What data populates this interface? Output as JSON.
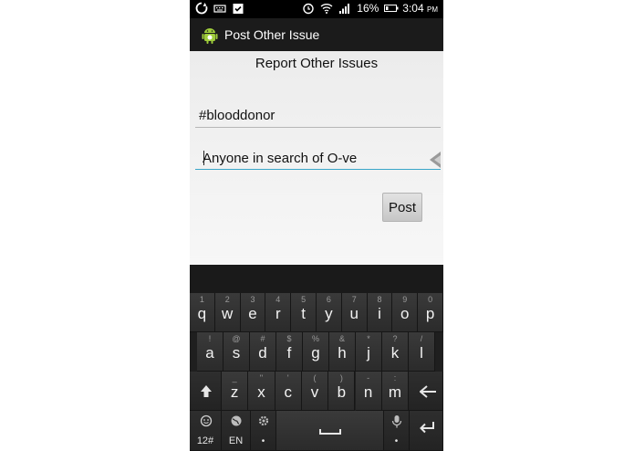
{
  "status_bar": {
    "battery": "16%",
    "time": "3:04",
    "ampm": "PM"
  },
  "action_bar": {
    "title": "Post Other Issue"
  },
  "content": {
    "heading": "Report Other Issues",
    "hashtag_value": "#blooddonor",
    "message_value": "Anyone in search of O-ve",
    "post_label": "Post"
  },
  "keyboard": {
    "row1": [
      {
        "main": "q",
        "sub": "1"
      },
      {
        "main": "w",
        "sub": "2"
      },
      {
        "main": "e",
        "sub": "3"
      },
      {
        "main": "r",
        "sub": "4"
      },
      {
        "main": "t",
        "sub": "5"
      },
      {
        "main": "y",
        "sub": "6"
      },
      {
        "main": "u",
        "sub": "7"
      },
      {
        "main": "i",
        "sub": "8"
      },
      {
        "main": "o",
        "sub": "9"
      },
      {
        "main": "p",
        "sub": "0"
      }
    ],
    "row2": [
      {
        "main": "a",
        "sub": "!"
      },
      {
        "main": "s",
        "sub": "@"
      },
      {
        "main": "d",
        "sub": "#"
      },
      {
        "main": "f",
        "sub": "$"
      },
      {
        "main": "g",
        "sub": "%"
      },
      {
        "main": "h",
        "sub": "&"
      },
      {
        "main": "j",
        "sub": "*"
      },
      {
        "main": "k",
        "sub": "?"
      },
      {
        "main": "l",
        "sub": "/"
      }
    ],
    "row3": [
      {
        "main": "z",
        "sub": "_"
      },
      {
        "main": "x",
        "sub": "\""
      },
      {
        "main": "c",
        "sub": "'"
      },
      {
        "main": "v",
        "sub": "("
      },
      {
        "main": "b",
        "sub": ")"
      },
      {
        "main": "n",
        "sub": "-"
      },
      {
        "main": "m",
        "sub": ":"
      }
    ],
    "symbols_label": "12#",
    "language_label": "EN"
  }
}
